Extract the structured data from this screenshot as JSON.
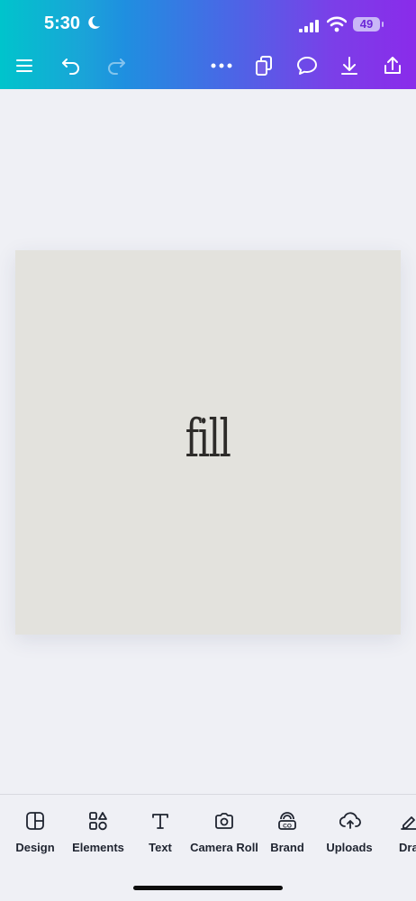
{
  "status_bar": {
    "time": "5:30",
    "battery_level": "49"
  },
  "toolbar": {
    "icons": [
      "menu-icon",
      "undo-icon",
      "redo-icon",
      "more-icon",
      "pages-icon",
      "comment-icon",
      "download-icon",
      "share-icon"
    ]
  },
  "canvas": {
    "text": "fill",
    "background": "#e3e2dd"
  },
  "bottom_tabs": [
    {
      "label": "Design",
      "icon": "design-icon"
    },
    {
      "label": "Elements",
      "icon": "elements-icon"
    },
    {
      "label": "Text",
      "icon": "text-icon"
    },
    {
      "label": "Camera Roll",
      "icon": "camera-icon"
    },
    {
      "label": "Brand",
      "icon": "brand-icon"
    },
    {
      "label": "Uploads",
      "icon": "uploads-icon"
    },
    {
      "label": "Dra",
      "icon": "draw-icon"
    }
  ],
  "colors": {
    "header_gradient_start": "#00c4cc",
    "header_gradient_end": "#8a2bea",
    "page_background": "#eff0f5"
  }
}
